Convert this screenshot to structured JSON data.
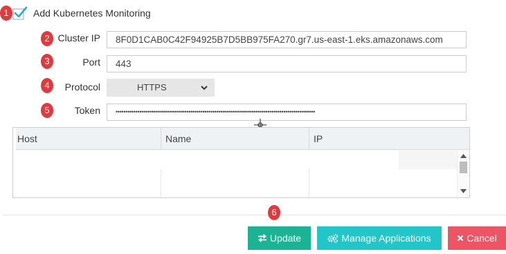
{
  "checkbox": {
    "label": "Add Kubernetes Monitoring",
    "checked": true
  },
  "badges": [
    "1",
    "2",
    "3",
    "4",
    "5",
    "6"
  ],
  "form": {
    "cluster_ip": {
      "label": "Cluster IP",
      "value": "8F0D1CAB0C42F94925B7D5BB975FA270.gr7.us-east-1.eks.amazonaws.com"
    },
    "port": {
      "label": "Port",
      "value": "443"
    },
    "protocol": {
      "label": "Protocol",
      "value": "HTTPS"
    },
    "token": {
      "label": "Token",
      "value": "•••••••••••••••••••••••••••••••••••••••••••••••••••••••••••••••••••••••••••••••••••••••••••••••••••••"
    }
  },
  "grid": {
    "columns": [
      "Host",
      "Name",
      "IP"
    ],
    "rows": []
  },
  "buttons": {
    "update": "Update",
    "manage": "Manage Applications",
    "cancel": "Cancel"
  },
  "colors": {
    "badge": "#e0393e",
    "checkmark": "#2aa8d8",
    "update": "#1bb394",
    "manage": "#23c6c8",
    "cancel": "#ed5565"
  },
  "icons": {
    "checkbox": "checkmark-icon",
    "protocol_select": "chevron-down-icon",
    "update": "exchange-arrows-icon",
    "manage": "cogs-icon",
    "cancel": "close-icon"
  }
}
